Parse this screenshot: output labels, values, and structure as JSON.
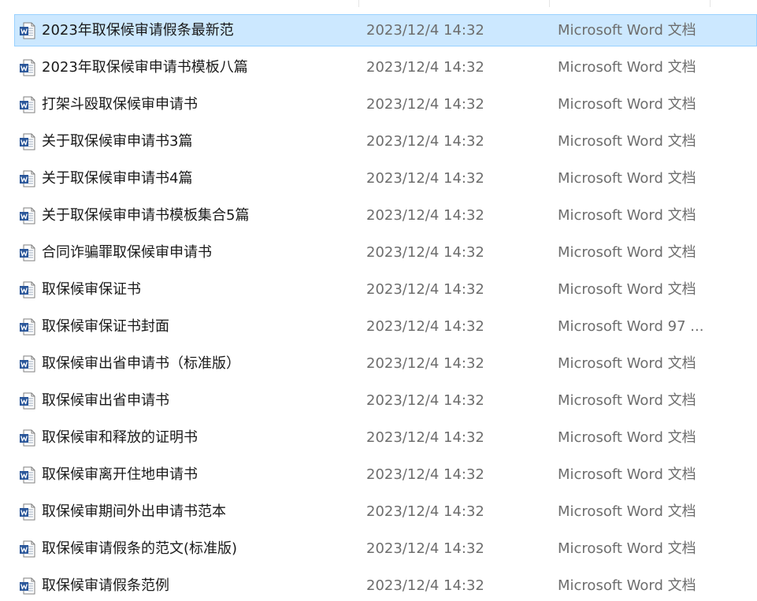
{
  "file_list": {
    "icon": "word-document-icon",
    "accent_color": "#2b579a",
    "selection_color": "#cce8ff",
    "items": [
      {
        "name": "2023年取保候审请假条最新范",
        "date": "2023/12/4 14:32",
        "type": "Microsoft Word 文档",
        "selected": true
      },
      {
        "name": "2023年取保候审申请书模板八篇",
        "date": "2023/12/4 14:32",
        "type": "Microsoft Word 文档",
        "selected": false
      },
      {
        "name": "打架斗殴取保候审申请书",
        "date": "2023/12/4 14:32",
        "type": "Microsoft Word 文档",
        "selected": false
      },
      {
        "name": "关于取保候审申请书3篇",
        "date": "2023/12/4 14:32",
        "type": "Microsoft Word 文档",
        "selected": false
      },
      {
        "name": "关于取保候审申请书4篇",
        "date": "2023/12/4 14:32",
        "type": "Microsoft Word 文档",
        "selected": false
      },
      {
        "name": "关于取保候审申请书模板集合5篇",
        "date": "2023/12/4 14:32",
        "type": "Microsoft Word 文档",
        "selected": false
      },
      {
        "name": "合同诈骗罪取保候审申请书",
        "date": "2023/12/4 14:32",
        "type": "Microsoft Word 文档",
        "selected": false
      },
      {
        "name": "取保候审保证书",
        "date": "2023/12/4 14:32",
        "type": "Microsoft Word 文档",
        "selected": false
      },
      {
        "name": "取保候审保证书封面",
        "date": "2023/12/4 14:32",
        "type": "Microsoft Word 97 ...",
        "selected": false
      },
      {
        "name": "取保候审出省申请书（标准版）",
        "date": "2023/12/4 14:32",
        "type": "Microsoft Word 文档",
        "selected": false
      },
      {
        "name": "取保候审出省申请书",
        "date": "2023/12/4 14:32",
        "type": "Microsoft Word 文档",
        "selected": false
      },
      {
        "name": "取保候审和释放的证明书",
        "date": "2023/12/4 14:32",
        "type": "Microsoft Word 文档",
        "selected": false
      },
      {
        "name": "取保候审离开住地申请书",
        "date": "2023/12/4 14:32",
        "type": "Microsoft Word 文档",
        "selected": false
      },
      {
        "name": "取保候审期间外出申请书范本",
        "date": "2023/12/4 14:32",
        "type": "Microsoft Word 文档",
        "selected": false
      },
      {
        "name": "取保候审请假条的范文(标准版)",
        "date": "2023/12/4 14:32",
        "type": "Microsoft Word 文档",
        "selected": false
      },
      {
        "name": "取保候审请假条范例",
        "date": "2023/12/4 14:32",
        "type": "Microsoft Word 文档",
        "selected": false
      }
    ]
  }
}
